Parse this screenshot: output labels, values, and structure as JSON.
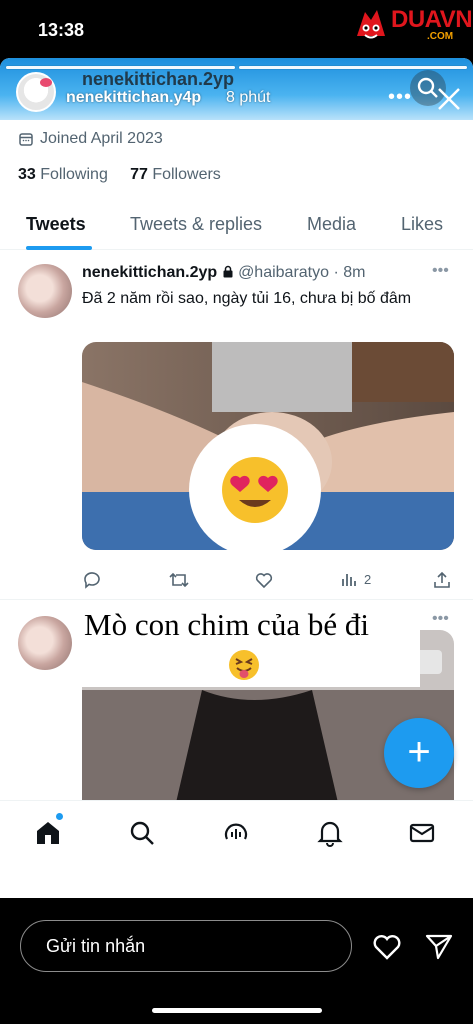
{
  "status_bar": {
    "time": "13:38"
  },
  "watermark": {
    "brand": "DUAVN",
    "domain": ".COM"
  },
  "story": {
    "username_behind": "nenekittichan.2yp",
    "username": "nenekittichan.y4p",
    "time_ago": "8 phút",
    "more_label": "•••",
    "close_icon": "close-icon",
    "search_icon": "search-icon"
  },
  "profile": {
    "joined": "Joined April 2023",
    "following_count": "33",
    "following_label": "Following",
    "followers_count": "77",
    "followers_label": "Followers"
  },
  "tabs": [
    {
      "label": "Tweets",
      "active": true
    },
    {
      "label": "Tweets & replies",
      "active": false
    },
    {
      "label": "Media",
      "active": false
    },
    {
      "label": "Likes",
      "active": false
    }
  ],
  "tweets": [
    {
      "name": "nenekittichan.2yp",
      "handle": "@haibaratyo",
      "time": "· 8m",
      "text": "Đã 2 năm rồi sao, ngày tủi 16, chưa bị bố đâm",
      "views": "2"
    },
    {
      "overlay_text": "Mò con chim của bé đi"
    }
  ],
  "fab": {
    "label": "+"
  },
  "reply": {
    "placeholder": "Gửi tin nhắn"
  },
  "colors": {
    "twitter_blue": "#1d9bf0",
    "text": "#0f1419",
    "muted": "#536471"
  }
}
